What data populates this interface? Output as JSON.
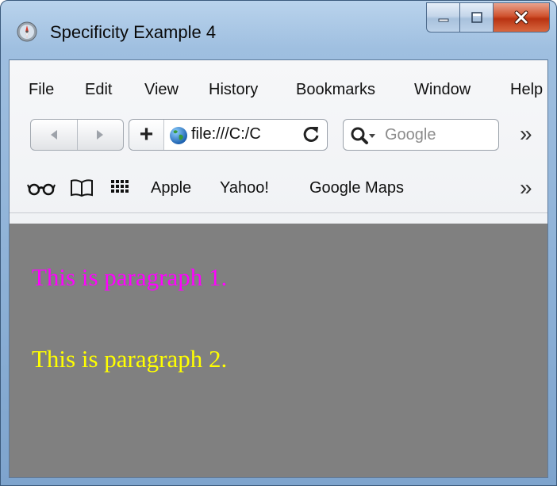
{
  "window": {
    "title": "Specificity Example 4"
  },
  "menu": {
    "items": [
      {
        "label": "File",
        "key": "F"
      },
      {
        "label": "Edit",
        "key": "E"
      },
      {
        "label": "View",
        "key": "V"
      },
      {
        "label": "History",
        "key": "s"
      },
      {
        "label": "Bookmarks",
        "key": "B"
      },
      {
        "label": "Window",
        "key": "W"
      },
      {
        "label": "Help",
        "key": "H"
      }
    ]
  },
  "toolbar": {
    "add_symbol": "+",
    "url": "file:///C:/C",
    "search_placeholder": "Google",
    "overflow_symbol": "»"
  },
  "bookmarks": {
    "items": [
      "Apple",
      "Yahoo!",
      "Google Maps"
    ],
    "overflow_symbol": "»",
    "icons": [
      "reader-glasses-icon",
      "open-book-icon",
      "grid-icon"
    ]
  },
  "content": {
    "paragraphs": [
      {
        "text": "This is paragraph 1.",
        "color": "#ff00ff"
      },
      {
        "text": "This is paragraph 2.",
        "color": "#ffff00"
      }
    ],
    "background": "#808080"
  }
}
